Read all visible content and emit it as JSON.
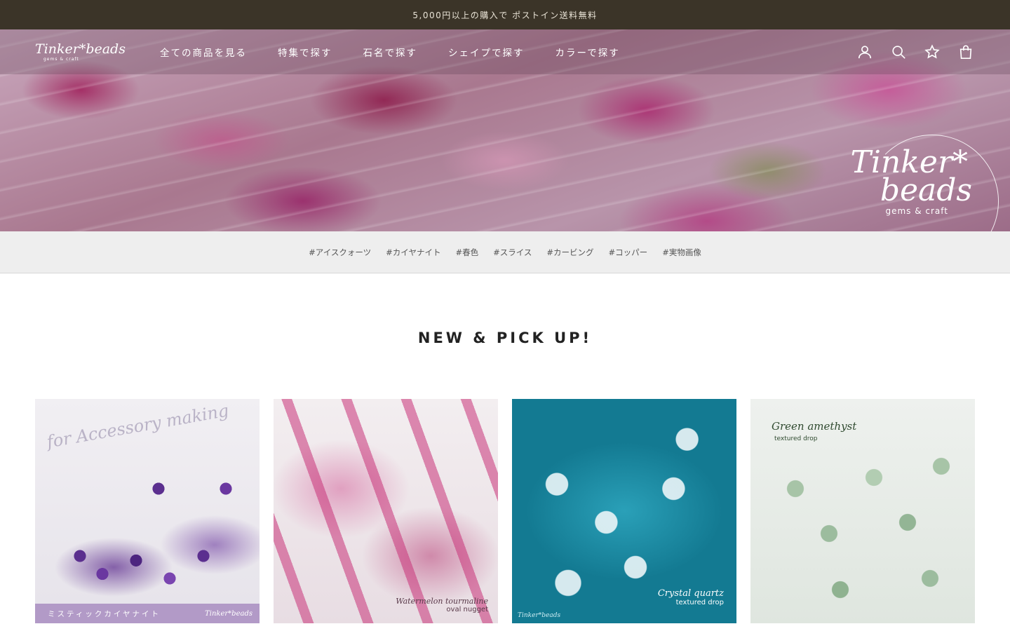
{
  "announcement": "5,000円以上の購入で ポストイン送料無料",
  "header": {
    "logo_text": "Tinker*beads",
    "logo_sub": "gems & craft",
    "menu": [
      {
        "label": "全ての商品を見る"
      },
      {
        "label": "特集で探す"
      },
      {
        "label": "石名で探す"
      },
      {
        "label": "シェイプで探す"
      },
      {
        "label": "カラーで探す"
      }
    ],
    "icons": [
      "account-icon",
      "search-icon",
      "wishlist-star-icon",
      "cart-bag-icon"
    ]
  },
  "hero": {
    "brand_line1": "Tinker*",
    "brand_line2": "beads",
    "brand_sub": "gems & craft"
  },
  "tags": [
    "#アイスクォーツ",
    "#カイヤナイト",
    "#春色",
    "#スライス",
    "#カービング",
    "#コッパー",
    "#実物画像"
  ],
  "section_title": "NEW & PICK UP!",
  "products": [
    {
      "overlay_script": "for Accessory making",
      "band_text": "ミスティックカイヤナイト",
      "band_logo": "Tinker*beads"
    },
    {
      "caption_main": "Watermelon tourmaline",
      "caption_sub": "oval nugget"
    },
    {
      "caption_main": "Crystal quartz",
      "caption_sub": "textured drop",
      "mini_logo": "Tinker*beads"
    },
    {
      "caption_main": "Green amethyst",
      "caption_sub": "textured drop"
    }
  ],
  "colors": {
    "announcement_bg": "#3b3428",
    "tag_bar_bg": "#eeeeee",
    "accent_purple": "#b29ac7"
  }
}
